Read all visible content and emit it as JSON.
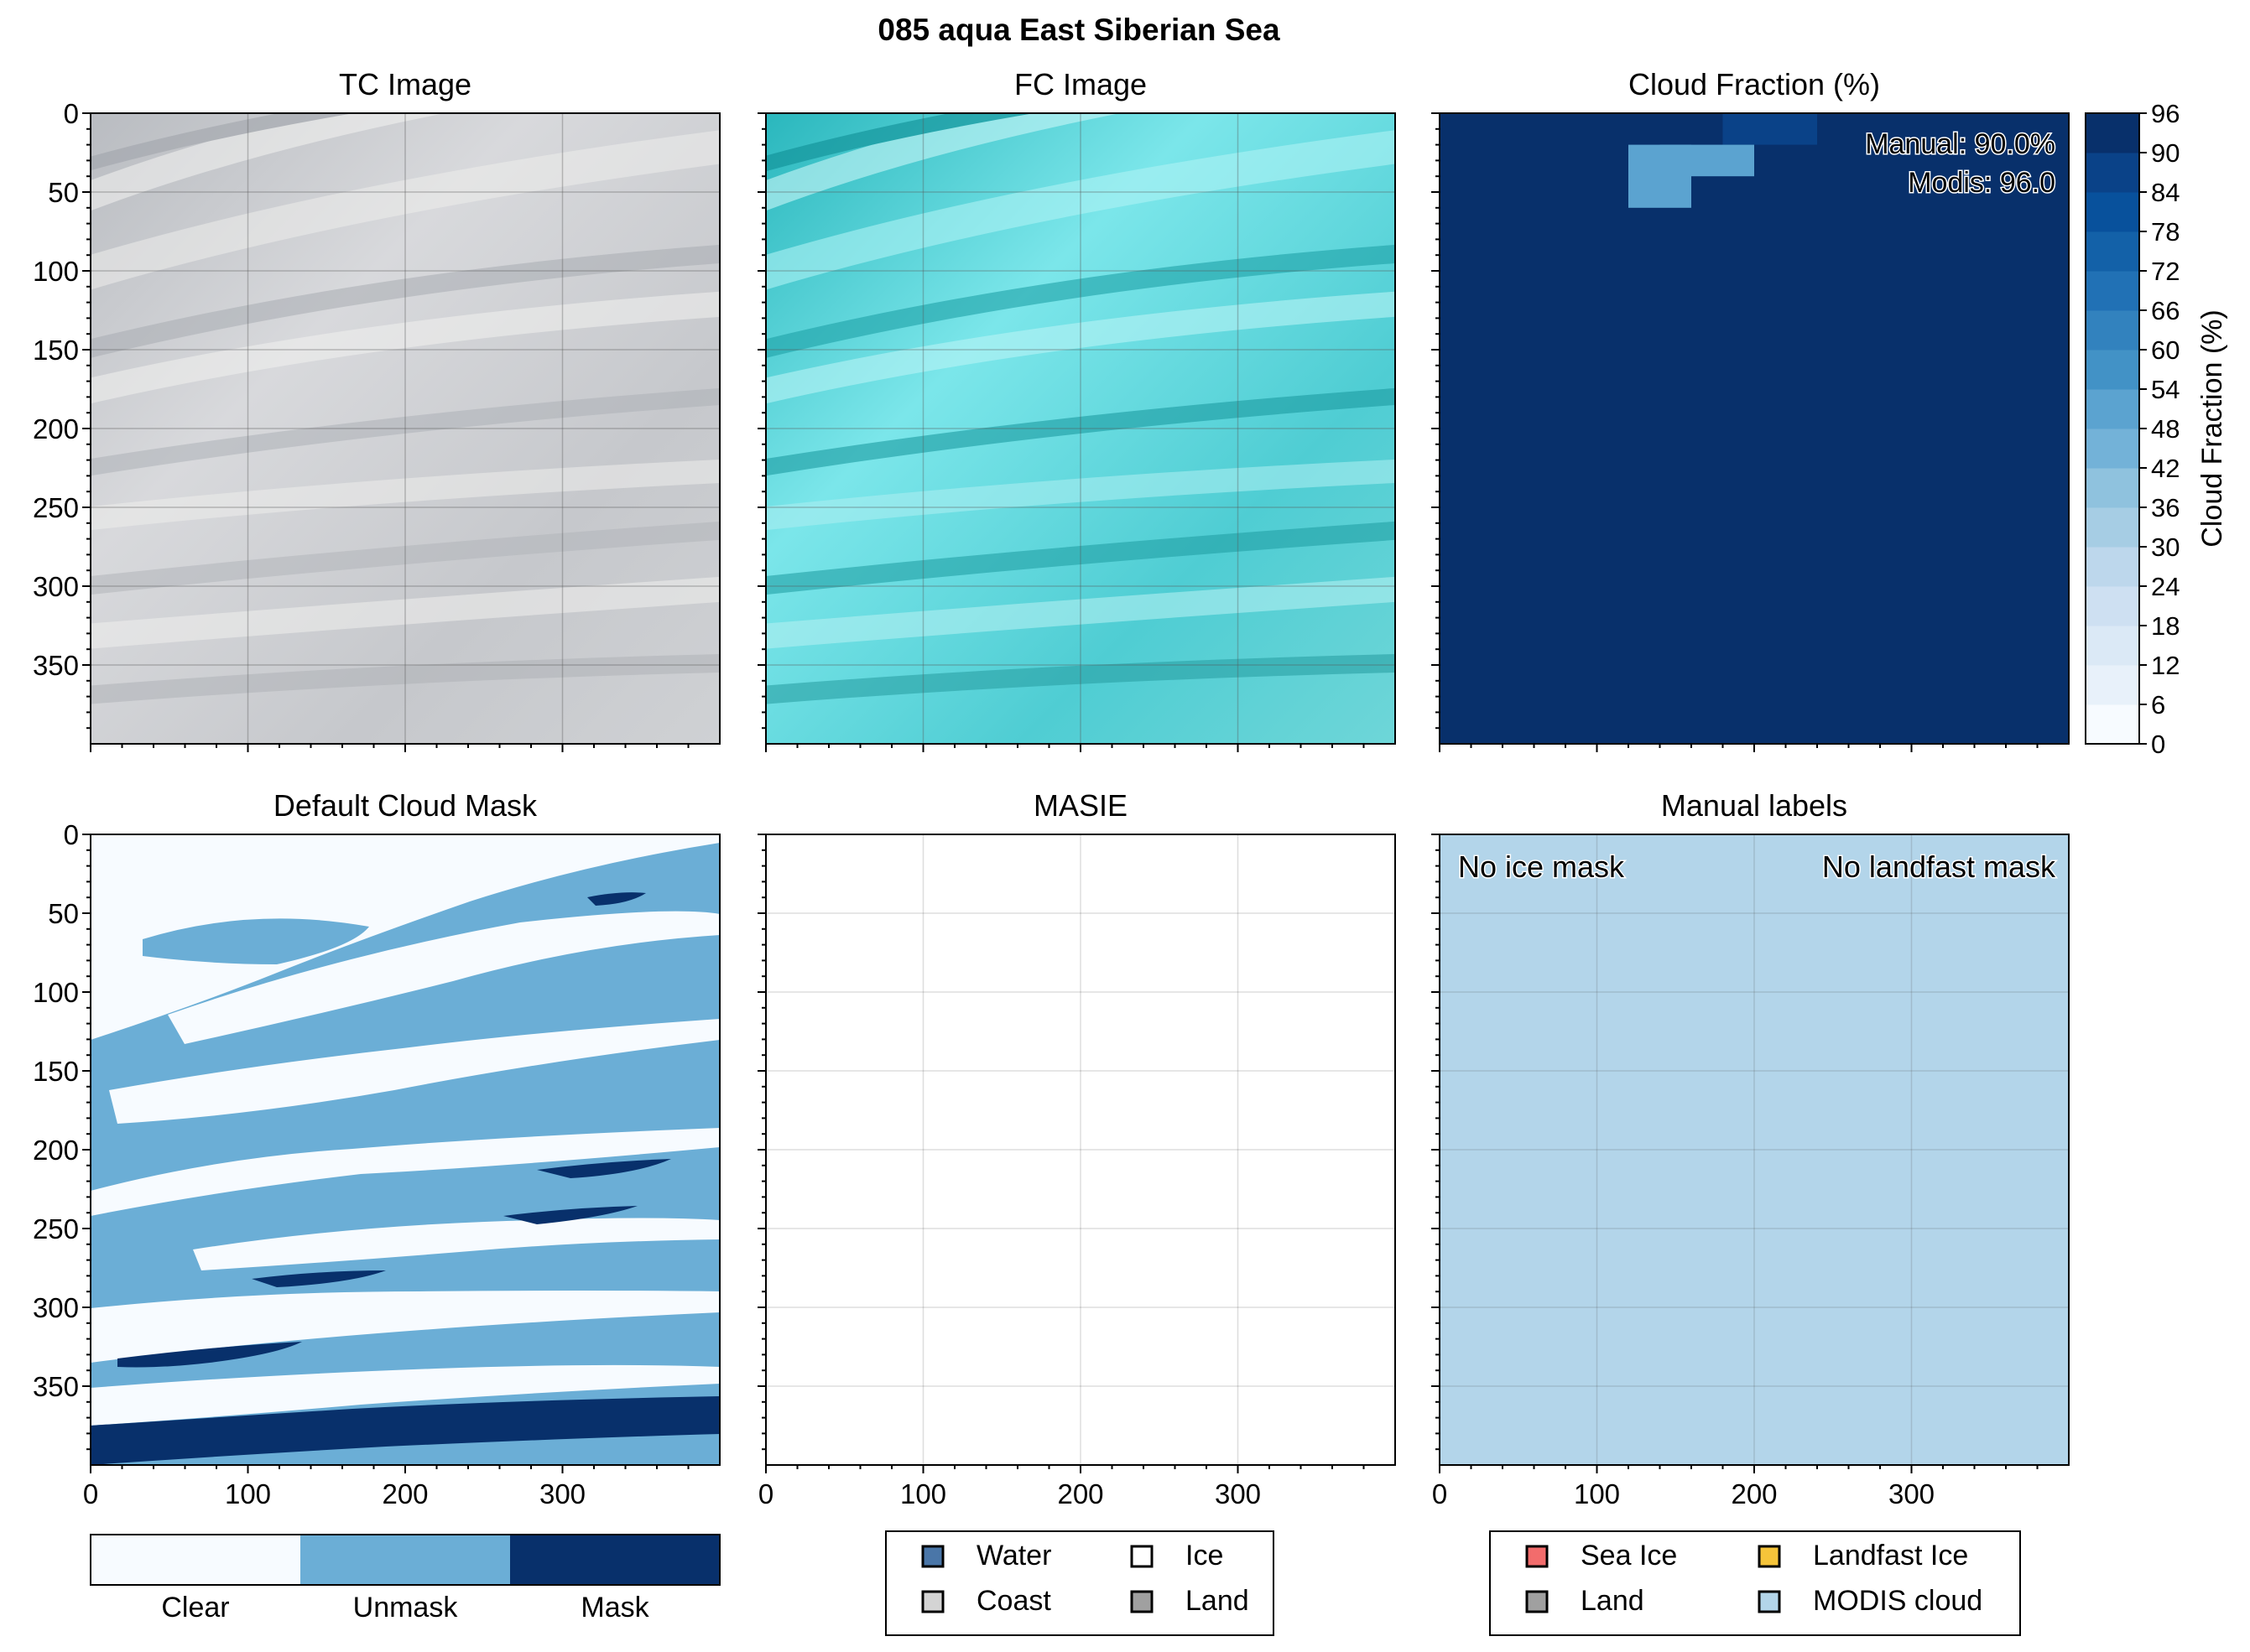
{
  "figure": {
    "suptitle": "085 aqua East Siberian Sea"
  },
  "chart_data": [
    {
      "type": "heatmap",
      "panel": "tc",
      "title": "TC Image",
      "xlim": [
        0,
        400
      ],
      "ylim": [
        400,
        0
      ],
      "xticks": [
        0,
        100,
        200,
        300
      ],
      "yticks": [
        0,
        50,
        100,
        150,
        200,
        250,
        300,
        350
      ],
      "show_x_tick_labels": false,
      "show_y_tick_labels": true,
      "grid": true,
      "content": "true-color satellite image, grey cloud streaks"
    },
    {
      "type": "heatmap",
      "panel": "fc",
      "title": "FC Image",
      "xlim": [
        0,
        400
      ],
      "ylim": [
        400,
        0
      ],
      "xticks": [
        0,
        100,
        200,
        300
      ],
      "yticks": [
        0,
        50,
        100,
        150,
        200,
        250,
        300,
        350
      ],
      "show_x_tick_labels": false,
      "show_y_tick_labels": false,
      "grid": true,
      "content": "false-color satellite image, cyan cloud streaks"
    },
    {
      "type": "heatmap",
      "panel": "cloud_fraction",
      "title": "Cloud Fraction (%)",
      "xlim": [
        0,
        400
      ],
      "ylim": [
        400,
        0
      ],
      "background_value": 96,
      "cells": [
        {
          "x0": 180,
          "x1": 240,
          "y0": 0,
          "y1": 20,
          "value": 84
        },
        {
          "x0": 140,
          "x1": 200,
          "y0": 20,
          "y1": 40,
          "value": 48
        },
        {
          "x0": 120,
          "x1": 160,
          "y0": 20,
          "y1": 60,
          "value": 48
        }
      ],
      "annotations": [
        "Manual: 90.0%",
        "Modis: 96.0"
      ],
      "colorbar": {
        "label": "Cloud Fraction (%)",
        "ticks": [
          0,
          6,
          12,
          18,
          24,
          30,
          36,
          42,
          48,
          54,
          60,
          66,
          72,
          78,
          84,
          90,
          96
        ],
        "range": [
          0,
          96
        ],
        "colors": [
          "#f7fbff",
          "#e8f1fa",
          "#dbe9f6",
          "#cee0f2",
          "#bdd7ec",
          "#a6cde4",
          "#8fc2de",
          "#73b2d8",
          "#5ba3d0",
          "#4292c6",
          "#3282be",
          "#2171b5",
          "#1361a8",
          "#08519c",
          "#0a4288",
          "#08306b"
        ]
      },
      "show_x_tick_labels": false,
      "show_y_tick_labels": false
    },
    {
      "type": "heatmap",
      "panel": "default_cloud_mask",
      "title": "Default Cloud Mask",
      "xlim": [
        0,
        400
      ],
      "ylim": [
        400,
        0
      ],
      "xticks": [
        0,
        100,
        200,
        300
      ],
      "yticks": [
        0,
        50,
        100,
        150,
        200,
        250,
        300,
        350
      ],
      "show_x_tick_labels": true,
      "show_y_tick_labels": true,
      "classes": [
        {
          "name": "Clear",
          "color": "#f7fbff"
        },
        {
          "name": "Unmask",
          "color": "#6baed6"
        },
        {
          "name": "Mask",
          "color": "#08306b"
        }
      ]
    },
    {
      "type": "heatmap",
      "panel": "masie",
      "title": "MASIE",
      "xlim": [
        0,
        400
      ],
      "ylim": [
        400,
        0
      ],
      "xticks": [
        0,
        100,
        200,
        300
      ],
      "show_x_tick_labels": true,
      "show_y_tick_labels": false,
      "grid": true,
      "legend": [
        {
          "name": "Water",
          "color": "#4a76a8"
        },
        {
          "name": "Ice",
          "color": "#ffffff"
        },
        {
          "name": "Coast",
          "color": "#d4d4d4"
        },
        {
          "name": "Land",
          "color": "#a0a0a0"
        }
      ]
    },
    {
      "type": "heatmap",
      "panel": "manual_labels",
      "title": "Manual labels",
      "xlim": [
        0,
        400
      ],
      "ylim": [
        400,
        0
      ],
      "xticks": [
        0,
        100,
        200,
        300
      ],
      "show_x_tick_labels": true,
      "show_y_tick_labels": false,
      "grid": true,
      "fill_class": "MODIS cloud",
      "annotations": [
        "No ice mask",
        "No landfast mask"
      ],
      "legend": [
        {
          "name": "Sea Ice",
          "color": "#f26c6c"
        },
        {
          "name": "Landfast Ice",
          "color": "#f5c43a"
        },
        {
          "name": "Land",
          "color": "#a0a0a0"
        },
        {
          "name": "MODIS cloud",
          "color": "#b3d5ea"
        }
      ]
    }
  ]
}
